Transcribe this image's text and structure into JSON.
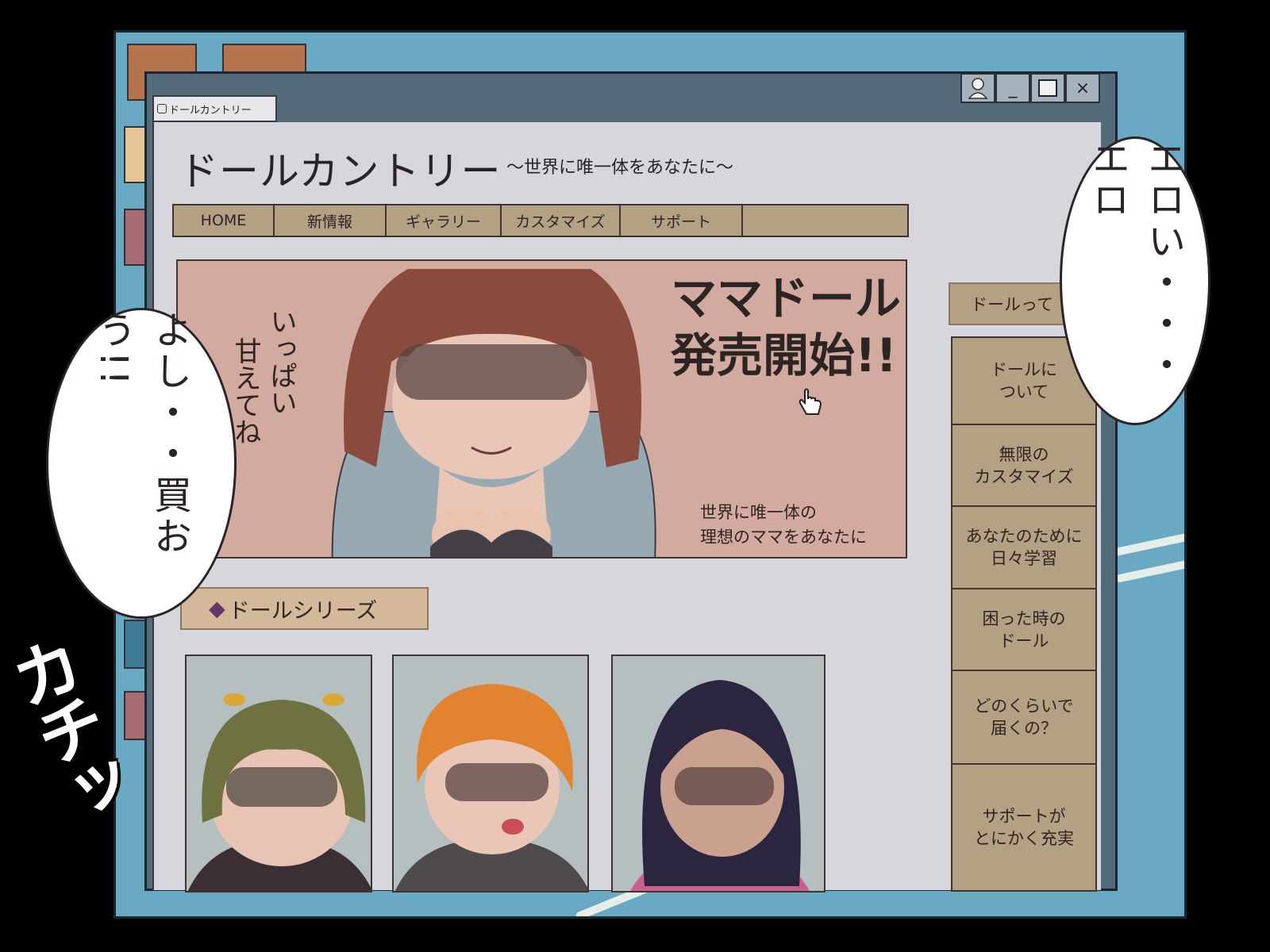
{
  "browser": {
    "tab_title": "ドールカントリー",
    "window_buttons": {
      "minimize": "_",
      "close": "×"
    }
  },
  "site": {
    "title": "ドールカントリー",
    "tagline": "～世界に唯一体をあなたに～",
    "nav": [
      "HOME",
      "新情報",
      "ギャラリー",
      "カスタマイズ",
      "サポート",
      ""
    ]
  },
  "banner": {
    "title_line1": "ママドール",
    "title_line2": "発売開始!!",
    "vertical_col1": "いっぱい",
    "vertical_col2": "甘えてね",
    "sub_line1": "世界に唯一体の",
    "sub_line2": "理想のママをあなたに"
  },
  "series": {
    "heading_mark": "◆",
    "heading": "ドールシリーズ"
  },
  "sidebar": {
    "heading": "ドールって",
    "items": [
      "ドールに\nついて",
      "無限の\nカスタマイズ",
      "あなたのために\n日々学習",
      "困った時の\nドール",
      "どのくらいで\n届くの？",
      "サポートが\nとにかく充実"
    ]
  },
  "overlay": {
    "bubble_left": "よし・・買おう!!",
    "bubble_right": "エロい・・・エロ",
    "sfx": "カチッ"
  },
  "colors": {
    "desktop": "#69a9c3",
    "window_frame": "#546b79",
    "page_bg": "#d7d6dc",
    "nav_tan": "#b4a184",
    "banner_pink": "#d3aa9f",
    "accent_purple": "#5e3a6a"
  }
}
